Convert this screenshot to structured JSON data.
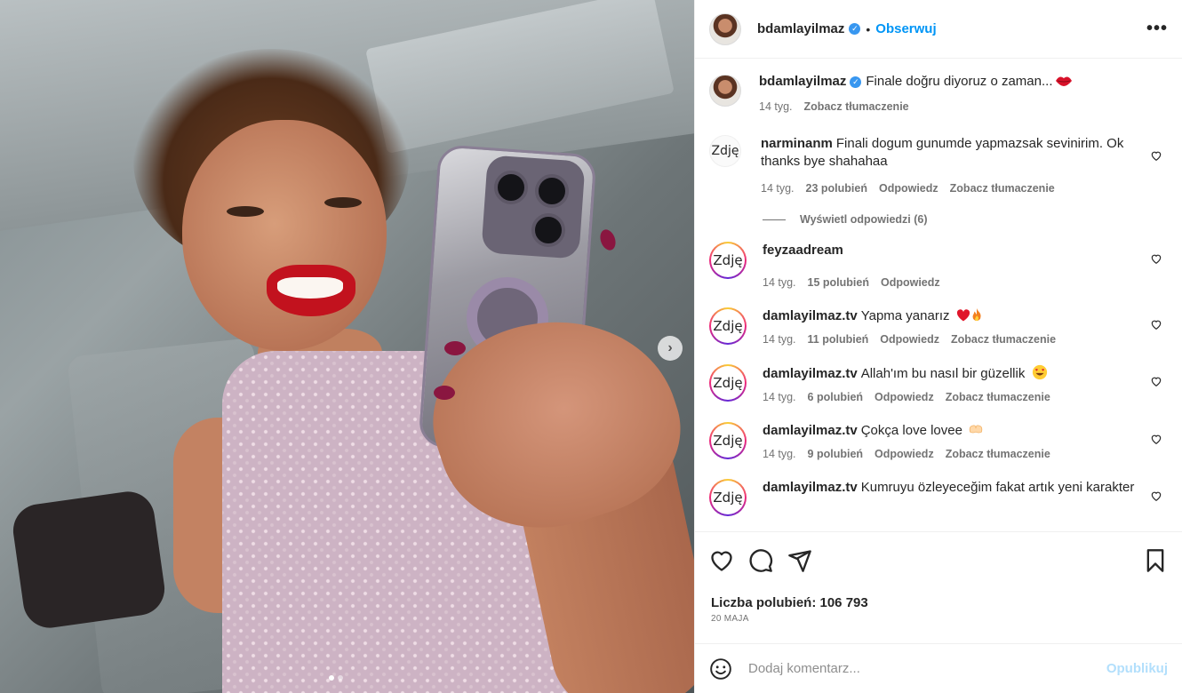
{
  "header": {
    "username": "bdamlayilmaz",
    "separator": "•",
    "follow_label": "Obserwuj",
    "more_label": "•••"
  },
  "caption": {
    "username": "bdamlayilmaz",
    "text": "Finale doğru diyoruz o zaman...",
    "time": "14 tyg.",
    "translate": "Zobacz tłumaczenie"
  },
  "comments": [
    {
      "avatar_text": "Zdję",
      "username": "narminanm",
      "text": "Finali dogum gunumde yapmazsak sevinirim. Ok thanks bye shahahaa",
      "time": "14 tyg.",
      "likes": "23 polubień",
      "reply": "Odpowiedz",
      "translate": "Zobacz tłumaczenie",
      "view_replies": "Wyświetl odpowiedzi (6)"
    },
    {
      "avatar_text": "Zdję",
      "username": "feyzaadream",
      "text": "",
      "time": "14 tyg.",
      "likes": "15 polubień",
      "reply": "Odpowiedz"
    },
    {
      "avatar_text": "Zdję",
      "username": "damlayilmaz.tv",
      "text": "Yapma yanarız",
      "time": "14 tyg.",
      "likes": "11 polubień",
      "reply": "Odpowiedz",
      "translate": "Zobacz tłumaczenie"
    },
    {
      "avatar_text": "Zdję",
      "username": "damlayilmaz.tv",
      "text": "Allah'ım bu nasıl bir güzellik",
      "time": "14 tyg.",
      "likes": "6 polubień",
      "reply": "Odpowiedz",
      "translate": "Zobacz tłumaczenie"
    },
    {
      "avatar_text": "Zdję",
      "username": "damlayilmaz.tv",
      "text": "Çokça love lovee",
      "time": "14 tyg.",
      "likes": "9 polubień",
      "reply": "Odpowiedz",
      "translate": "Zobacz tłumaczenie"
    },
    {
      "avatar_text": "Zdję",
      "username": "damlayilmaz.tv",
      "text": "Kumruyu özleyeceğim fakat artık yeni karakter"
    }
  ],
  "likes": {
    "count_label": "Liczba polubień: 106 793",
    "date": "20 MAJA"
  },
  "add_comment": {
    "placeholder": "Dodaj komentarz...",
    "post_label": "Opublikuj"
  },
  "carousel": {
    "next_label": "›"
  },
  "icons": {
    "verified": "verified-badge-icon",
    "heart": "heart-icon",
    "comment": "comment-icon",
    "share": "share-icon",
    "save": "bookmark-icon",
    "emoji": "smiley-icon"
  },
  "colors": {
    "accent": "#0095f6",
    "verified": "#3897f0",
    "post_disabled": "#b2dffc"
  }
}
